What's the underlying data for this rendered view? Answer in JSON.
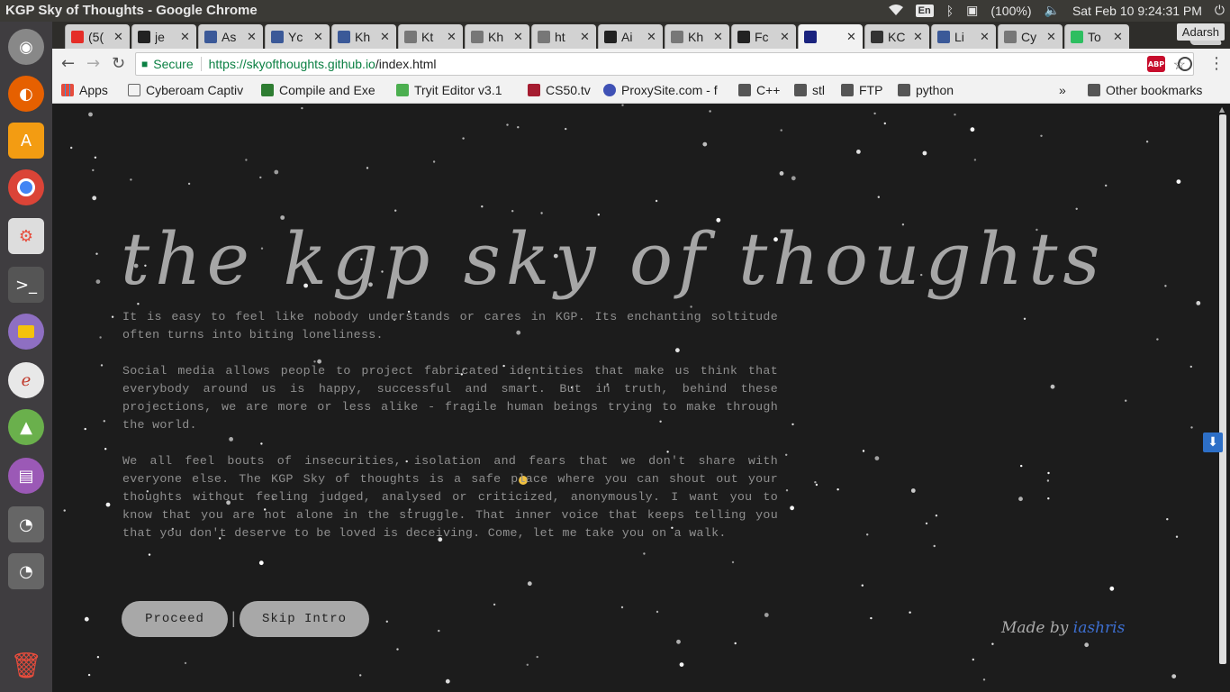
{
  "system": {
    "window_title": "KGP Sky of Thoughts - Google Chrome",
    "lang": "En",
    "battery": "(100%)",
    "datetime": "Sat Feb 10  9:24:31 PM"
  },
  "launcher": {
    "items": [
      "ubuntu-icon",
      "firefox-icon",
      "software-center-icon",
      "chrome-icon",
      "settings-toggle-icon",
      "terminal-icon",
      "files-icon",
      "writer-icon",
      "image-viewer-icon",
      "document-icon",
      "disk-icon",
      "disk-icon",
      "trash-icon"
    ]
  },
  "tabs": [
    {
      "label": "(5(",
      "icon": "youtube-icon",
      "color": "#e52d27"
    },
    {
      "label": "je",
      "icon": "github-icon",
      "color": "#222222"
    },
    {
      "label": "As",
      "icon": "facebook-icon",
      "color": "#3b5998"
    },
    {
      "label": "Yc",
      "icon": "facebook-icon",
      "color": "#3b5998"
    },
    {
      "label": "Kh",
      "icon": "facebook-icon",
      "color": "#3b5998"
    },
    {
      "label": "Kt",
      "icon": "ghost-icon",
      "color": "#777777"
    },
    {
      "label": "Kh",
      "icon": "ghost-icon",
      "color": "#777777"
    },
    {
      "label": "ht",
      "icon": "page-icon",
      "color": "#777777"
    },
    {
      "label": "Ai",
      "icon": "github-icon",
      "color": "#222222"
    },
    {
      "label": "Kh",
      "icon": "ghost-icon",
      "color": "#777777"
    },
    {
      "label": "Fc",
      "icon": "github-icon",
      "color": "#222222"
    },
    {
      "label": "",
      "icon": "sky-icon",
      "color": "#1a237e"
    },
    {
      "label": "KC",
      "icon": "quill-icon",
      "color": "#333333"
    },
    {
      "label": "Li",
      "icon": "facebook-icon",
      "color": "#3b5998"
    },
    {
      "label": "Cy",
      "icon": "page-icon",
      "color": "#777777"
    },
    {
      "label": "To",
      "icon": "evernote-icon",
      "color": "#2dbe60"
    }
  ],
  "profile": "Adarsh",
  "omnibox": {
    "secure_label": "Secure",
    "url_host": "https://skyofthoughts.github.io",
    "url_rest": "/index.html"
  },
  "bookmarks": [
    {
      "label": "Apps",
      "icon": "apps-icon"
    },
    {
      "label": "Cyberoam Captiv",
      "icon": "page-icon"
    },
    {
      "label": "Compile and Exe",
      "icon": "code-icon"
    },
    {
      "label": "Tryit Editor v3.1",
      "icon": "w3-icon"
    },
    {
      "label": "CS50.tv",
      "icon": "harvard-icon"
    },
    {
      "label": "ProxySite.com - f",
      "icon": "shield-icon"
    },
    {
      "label": "C++",
      "icon": "folder-icon"
    },
    {
      "label": "stl",
      "icon": "folder-icon"
    },
    {
      "label": "FTP",
      "icon": "folder-icon"
    },
    {
      "label": "python",
      "icon": "folder-icon"
    }
  ],
  "bookmarks_overflow": "»",
  "other_bookmarks": "Other bookmarks",
  "page": {
    "title": "the kgp sky of thoughts",
    "paragraphs": [
      "It is easy to feel like nobody understands or cares in KGP. Its enchanting soltitude often turns into biting loneliness.",
      "Social media allows people to project fabricated identities that make us think that everybody around us is happy, successful and smart. But in truth, behind these projections, we are more or less alike - fragile human beings trying to make through the world.",
      "We all feel bouts of insecurities, isolation and fears that we don't share with everyone else. The KGP Sky of thoughts is a safe place where you can shout out your thoughts without feeling judged, analysed or criticized, anonymously. I want you to know that you are not alone in the struggle. That inner voice that keeps telling you that you don't deserve to be loved is deceiving. Come, let me take you on a walk."
    ],
    "proceed_label": "Proceed",
    "separator": "|",
    "skip_label": "Skip Intro",
    "credit_prefix": "Made by",
    "credit_author": "iashris"
  }
}
